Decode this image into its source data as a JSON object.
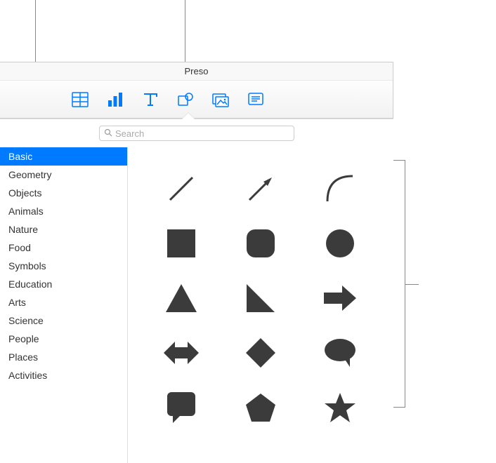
{
  "window": {
    "title": "Preso"
  },
  "toolbar": {
    "icons": [
      {
        "name": "table-icon"
      },
      {
        "name": "chart-icon"
      },
      {
        "name": "text-icon"
      },
      {
        "name": "shape-icon"
      },
      {
        "name": "media-icon"
      },
      {
        "name": "comment-icon"
      }
    ]
  },
  "search": {
    "placeholder": "Search"
  },
  "sidebar": {
    "items": [
      {
        "label": "Basic",
        "selected": true
      },
      {
        "label": "Geometry",
        "selected": false
      },
      {
        "label": "Objects",
        "selected": false
      },
      {
        "label": "Animals",
        "selected": false
      },
      {
        "label": "Nature",
        "selected": false
      },
      {
        "label": "Food",
        "selected": false
      },
      {
        "label": "Symbols",
        "selected": false
      },
      {
        "label": "Education",
        "selected": false
      },
      {
        "label": "Arts",
        "selected": false
      },
      {
        "label": "Science",
        "selected": false
      },
      {
        "label": "People",
        "selected": false
      },
      {
        "label": "Places",
        "selected": false
      },
      {
        "label": "Activities",
        "selected": false
      }
    ]
  },
  "shapes": [
    {
      "name": "line"
    },
    {
      "name": "arrow-line"
    },
    {
      "name": "curve"
    },
    {
      "name": "square"
    },
    {
      "name": "rounded-square"
    },
    {
      "name": "circle"
    },
    {
      "name": "triangle"
    },
    {
      "name": "right-triangle"
    },
    {
      "name": "arrow-right"
    },
    {
      "name": "arrow-left-right"
    },
    {
      "name": "diamond"
    },
    {
      "name": "speech-bubble"
    },
    {
      "name": "callout-square"
    },
    {
      "name": "pentagon"
    },
    {
      "name": "star"
    }
  ]
}
